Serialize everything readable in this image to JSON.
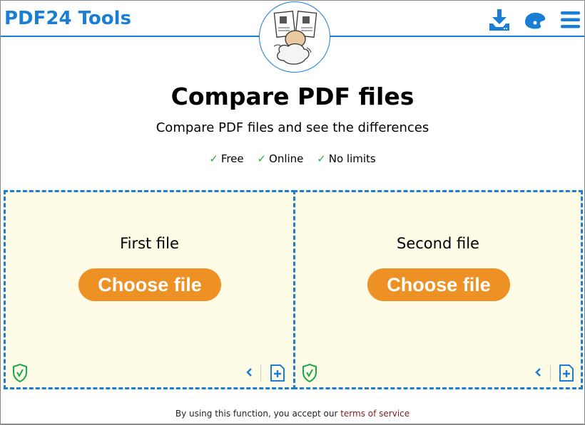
{
  "header": {
    "logo_text": "PDF24 Tools",
    "icons": [
      "download-icon",
      "palette-icon",
      "menu-icon"
    ],
    "brand_color": "#1a7ed4"
  },
  "main": {
    "title": "Compare PDF files",
    "subtitle": "Compare PDF files and see the differences",
    "features": [
      {
        "check": "✓",
        "label": "Free"
      },
      {
        "check": "✓",
        "label": "Online"
      },
      {
        "check": "✓",
        "label": "No limits"
      }
    ]
  },
  "dropzones": [
    {
      "label": "First file",
      "button": "Choose file"
    },
    {
      "label": "Second file",
      "button": "Choose file"
    }
  ],
  "colors": {
    "accent_button": "#ee9124",
    "dropzone_bg": "#fdfbe6",
    "check_green": "#2aa84a"
  },
  "footer": {
    "text": "By using this function, you accept our ",
    "link": "terms of service"
  }
}
